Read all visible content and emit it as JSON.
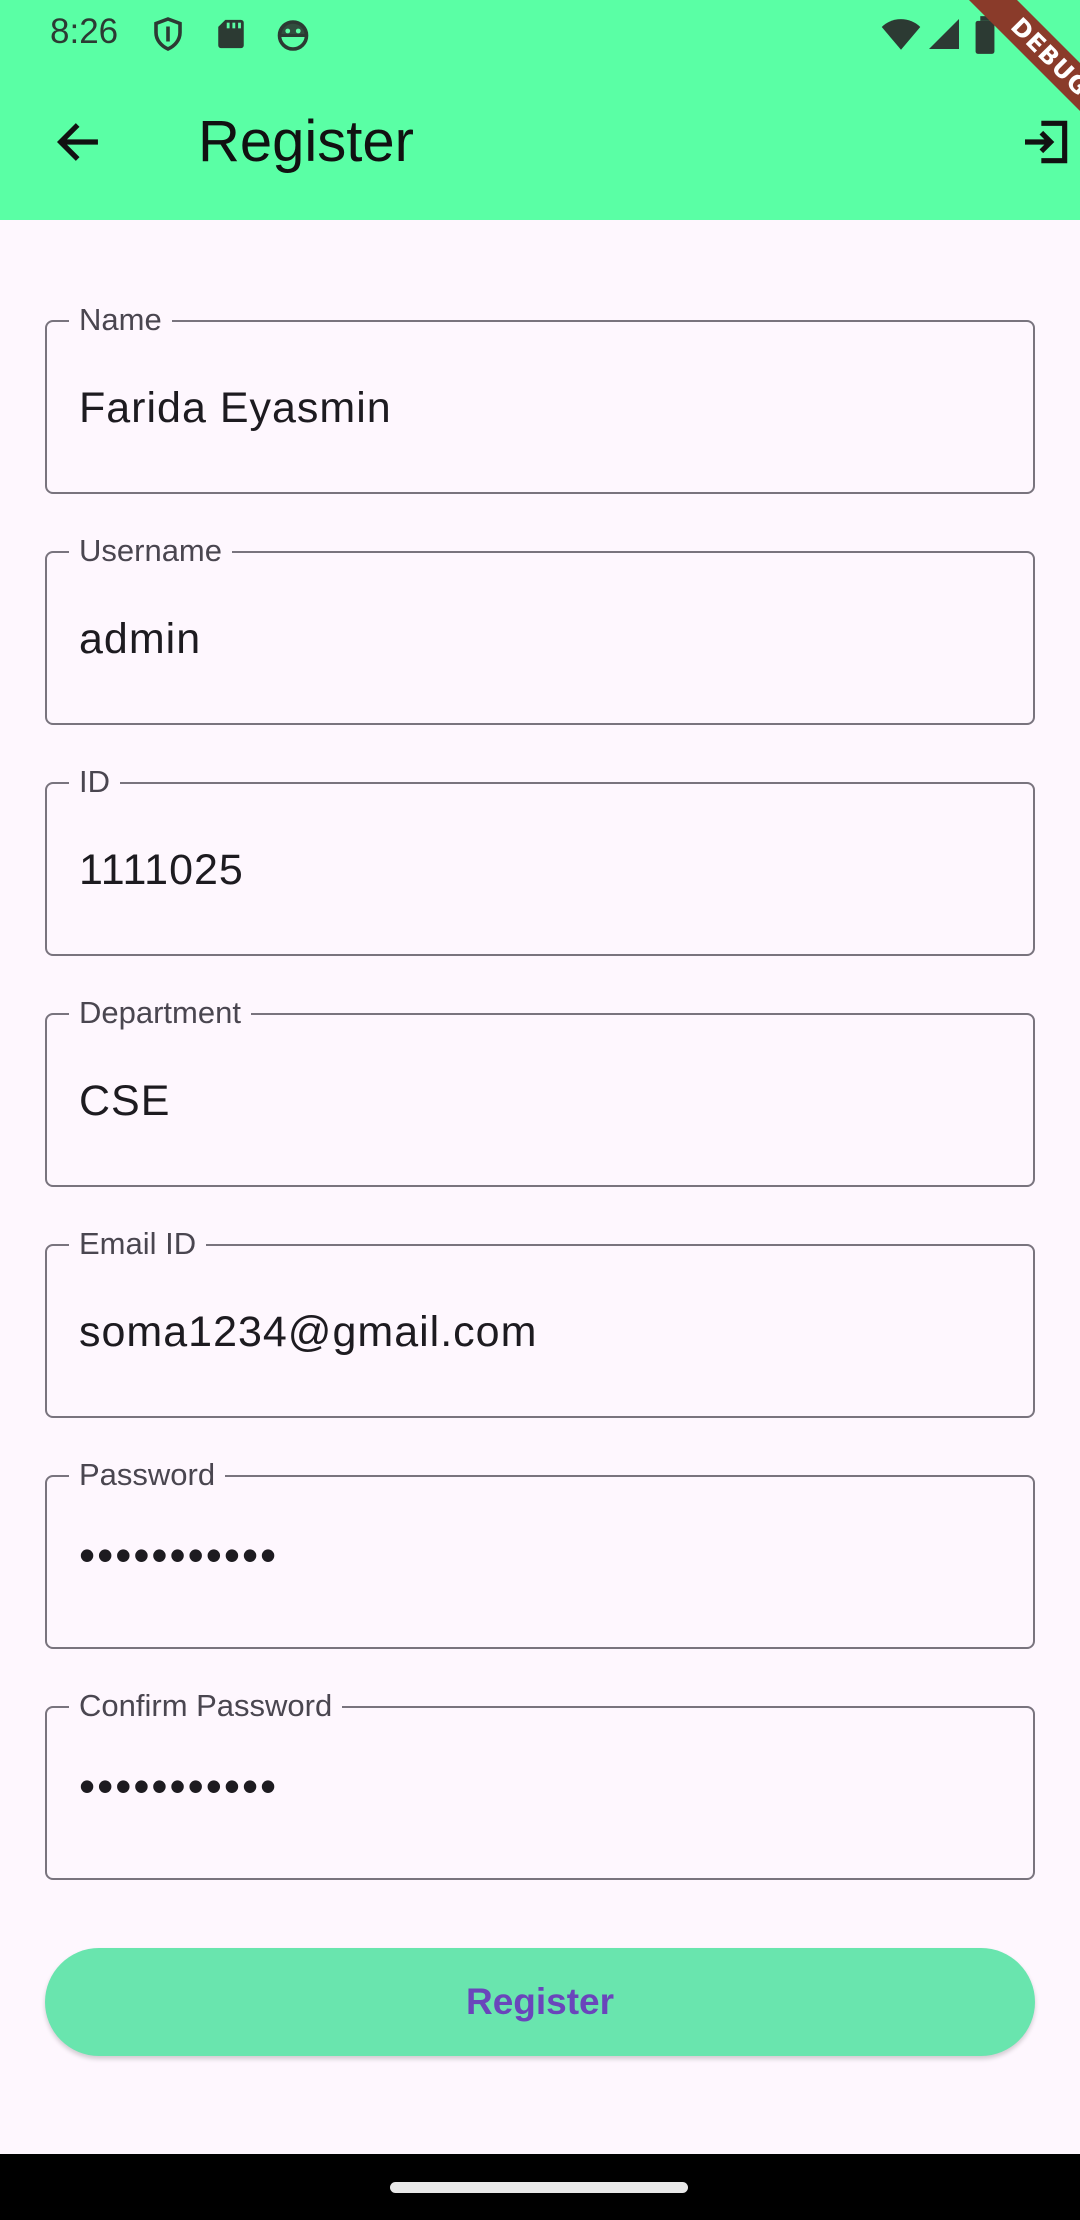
{
  "status_bar": {
    "time": "8:26",
    "icons": [
      "shield-icon",
      "sd-card-icon",
      "android-face-icon",
      "wifi-icon",
      "signal-icon",
      "battery-icon"
    ]
  },
  "toolbar": {
    "title": "Register",
    "back_icon": "arrow-left-icon",
    "action_icon": "login-icon"
  },
  "debug_banner": "DEBUG",
  "colors": {
    "appbar": "#5affa5",
    "background": "#fef7fe",
    "button": "#69e5ae",
    "button_text": "#6a45bb",
    "debug_banner": "#8a3b2a"
  },
  "form": {
    "fields": [
      {
        "label": "Name",
        "value": "Farida Eyasmin"
      },
      {
        "label": "Username",
        "value": "admin"
      },
      {
        "label": "ID",
        "value": "1111025"
      },
      {
        "label": "Department",
        "value": "CSE"
      },
      {
        "label": "Email ID",
        "value": "soma1234@gmail.com"
      },
      {
        "label": "Password",
        "value": "•••••••••••"
      },
      {
        "label": "Confirm Password",
        "value": "•••••••••••"
      }
    ],
    "submit_label": "Register"
  }
}
